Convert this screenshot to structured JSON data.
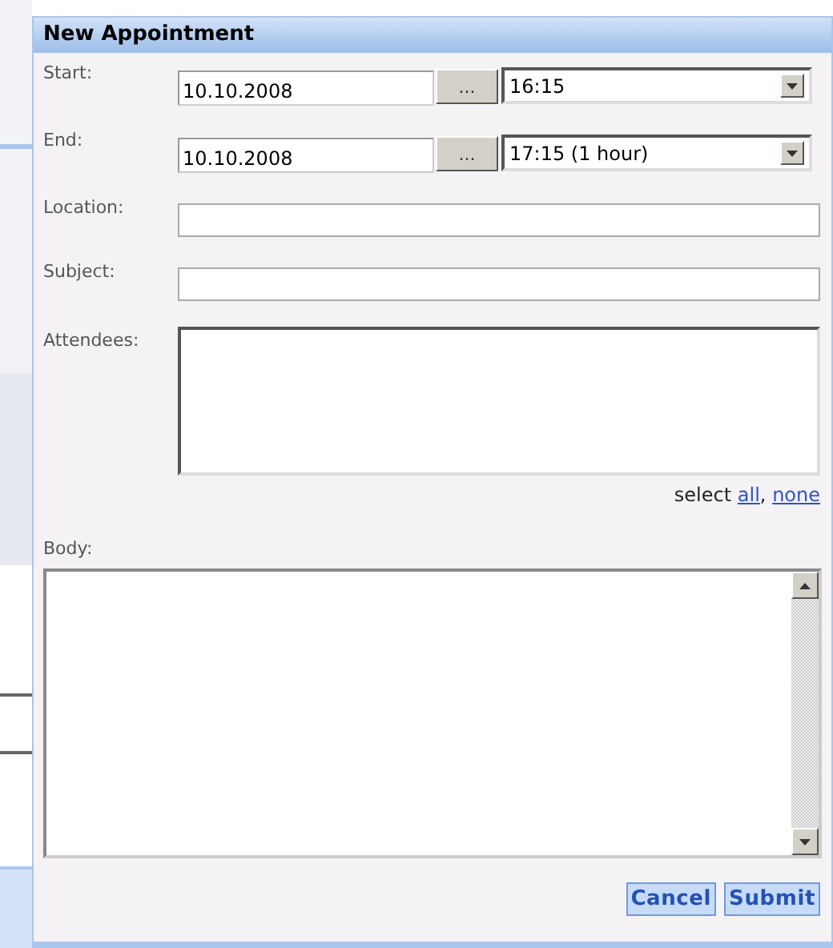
{
  "dialog": {
    "title": "New Appointment"
  },
  "start": {
    "label": "Start:",
    "date": "10.10.2008",
    "picker": "...",
    "time": "16:15"
  },
  "end": {
    "label": "End:",
    "date": "10.10.2008",
    "picker": "...",
    "time": "17:15 (1 hour)"
  },
  "location": {
    "label": "Location:"
  },
  "subject": {
    "label": "Subject:"
  },
  "attendees": {
    "label": "Attendees:",
    "select_text": "select",
    "links": [
      "all",
      "none"
    ],
    "separator": ","
  },
  "body": {
    "label": "Body:"
  },
  "buttons": [
    "Cancel",
    "Submit"
  ]
}
